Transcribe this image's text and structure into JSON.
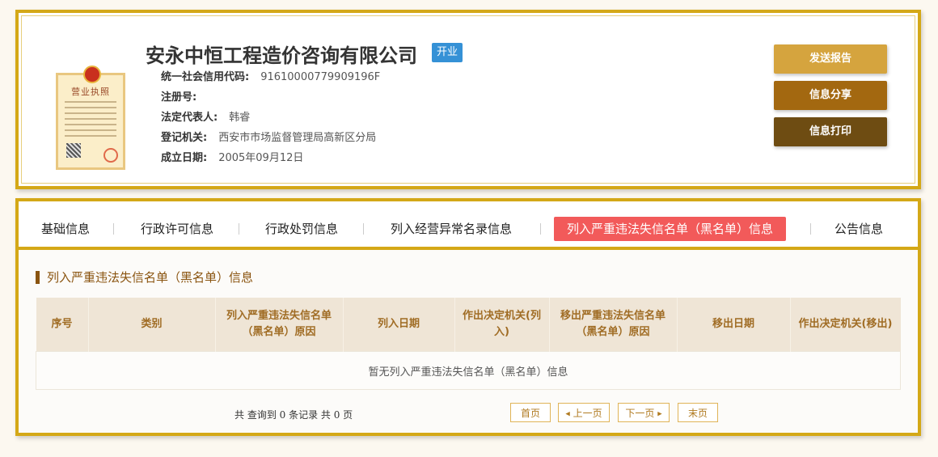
{
  "company": {
    "name": "安永中恒工程造价咨询有限公司",
    "status": "开业",
    "fields": [
      {
        "label": "统一社会信用代码:",
        "value": "91610000779909196F"
      },
      {
        "label": "注册号:",
        "value": ""
      },
      {
        "label": "法定代表人:",
        "value": "韩睿"
      },
      {
        "label": "登记机关:",
        "value": "西安市市场监督管理局高新区分局"
      },
      {
        "label": "成立日期:",
        "value": "2005年09月12日"
      }
    ]
  },
  "license": {
    "title": "营业执照"
  },
  "actions": {
    "report": "发送报告",
    "share": "信息分享",
    "print": "信息打印"
  },
  "tabs": [
    {
      "label": "基础信息"
    },
    {
      "label": "行政许可信息"
    },
    {
      "label": "行政处罚信息"
    },
    {
      "label": "列入经营异常名录信息"
    },
    {
      "label": "列入严重违法失信名单（黑名单）信息"
    },
    {
      "label": "公告信息"
    }
  ],
  "section_title": "列入严重违法失信名单（黑名单）信息",
  "table": {
    "headers": [
      "序号",
      "类别",
      "列入严重违法失信名单（黑名单）原因",
      "列入日期",
      "作出决定机关(列入)",
      "移出严重违法失信名单（黑名单）原因",
      "移出日期",
      "作出决定机关(移出)"
    ],
    "empty_text": "暂无列入严重违法失信名单（黑名单）信息"
  },
  "pagination": {
    "summary": "共 查询到 0 条记录 共 0 页",
    "first": "首页",
    "prev": "上一页",
    "next": "下一页",
    "last": "末页"
  },
  "colors": {
    "border": "#d4a817",
    "btn_report": "#d5a43e",
    "btn_share": "#a36810",
    "btn_print": "#6e4c12",
    "tab_active": "#f25a5a",
    "status_badge": "#3591d6"
  }
}
